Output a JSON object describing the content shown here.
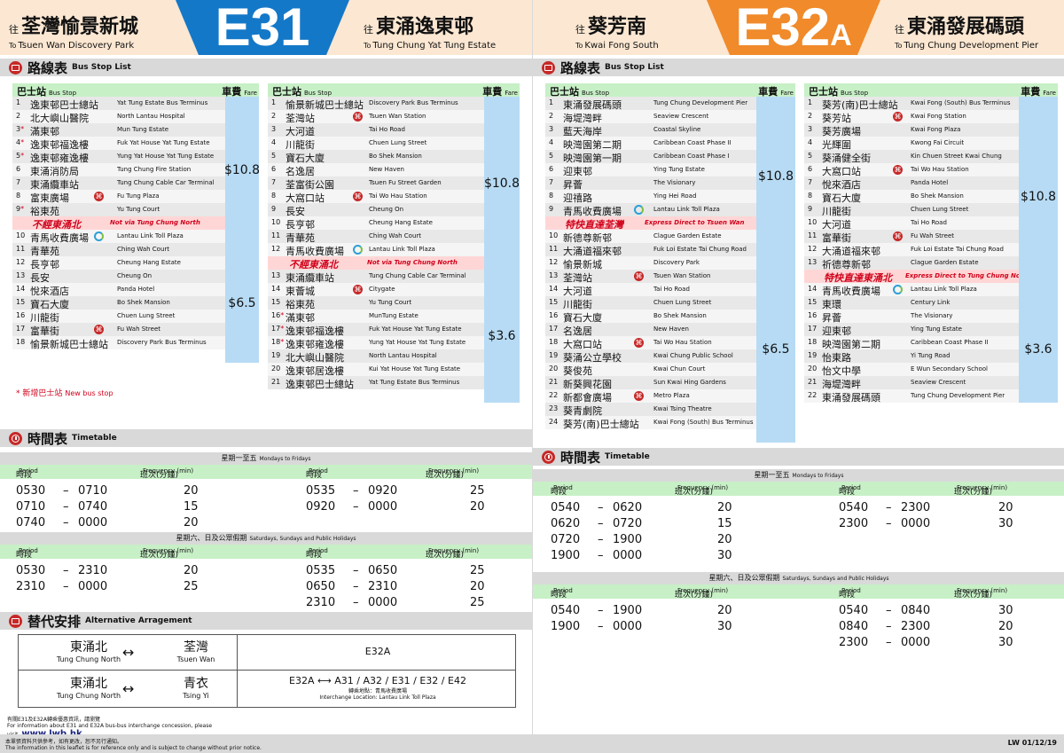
{
  "colors": {
    "e31_badge": "#1478c8",
    "e32a_badge": "#f08a2a",
    "header_bg": "#fbe7d2",
    "section_bar": "#d9d9d9",
    "green_head": "#c7f0c6",
    "fare_blue": "#b7dbf4",
    "express_pink": "#ffd6d6",
    "red": "#d0021b"
  },
  "left": {
    "header": {
      "origin_prefix": "往",
      "origin_zh": "荃灣愉景新城",
      "origin_to": "To",
      "origin_en": "Tsuen Wan Discovery Park",
      "route": "E31",
      "dest_prefix": "往",
      "dest_zh": "東涌逸東邨",
      "dest_to": "To",
      "dest_en": "Tung Chung Yat Tung Estate"
    },
    "stops_title": {
      "zh": "路線表",
      "en": "Bus Stop List"
    },
    "stop_header": {
      "stop_zh": "巴士站",
      "stop_en": "Bus Stop",
      "fare_zh": "車費",
      "fare_en": "Fare"
    },
    "col1": [
      {
        "n": "1",
        "zh": "逸東邨巴士總站",
        "en": "Yat Tung Estate Bus Terminus"
      },
      {
        "n": "2",
        "zh": "北大嶼山醫院",
        "en": "North Lantau Hospital"
      },
      {
        "n": "3",
        "ast": "*",
        "zh": "滿東邨",
        "en": "Mun Tung Estate"
      },
      {
        "n": "4",
        "ast": "*",
        "zh": "逸東邨福逸樓",
        "en": "Fuk Yat House Yat Tung Estate"
      },
      {
        "n": "5",
        "ast": "*",
        "zh": "逸東邨雍逸樓",
        "en": "Yung Yat House Yat Tung Estate"
      },
      {
        "n": "6",
        "zh": "東涌消防局",
        "en": "Tung Chung Fire Station"
      },
      {
        "n": "7",
        "zh": "東涌纜車站",
        "en": "Tung Chung Cable Car Terminal"
      },
      {
        "n": "8",
        "zh": "富東廣場",
        "en": "Fu Tung Plaza",
        "mtr": true
      },
      {
        "n": "9",
        "ast": "*",
        "zh": "裕東苑",
        "en": "Yu Tung Court"
      },
      {
        "exp": true,
        "zh": "不經東涌北",
        "en": "Not via Tung Chung North"
      },
      {
        "n": "10",
        "zh": "青馬收費廣場",
        "en": "Lantau Link Toll Plaza",
        "toll": true
      },
      {
        "n": "11",
        "zh": "青華苑",
        "en": "Ching Wah Court"
      },
      {
        "n": "12",
        "zh": "長亨邨",
        "en": "Cheung Hang Estate"
      },
      {
        "n": "13",
        "zh": "長安",
        "en": "Cheung On"
      },
      {
        "n": "14",
        "zh": "悅來酒店",
        "en": "Panda Hotel"
      },
      {
        "n": "15",
        "zh": "寶石大廈",
        "en": "Bo Shek Mansion"
      },
      {
        "n": "16",
        "zh": "川龍街",
        "en": "Chuen Lung Street"
      },
      {
        "n": "17",
        "zh": "富華街",
        "en": "Fu Wah Street",
        "mtr": true
      },
      {
        "n": "18",
        "zh": "愉景新城巴士總站",
        "en": "Discovery Park Bus Terminus"
      }
    ],
    "col1_fares": [
      "$10.8",
      "$6.5"
    ],
    "col2": [
      {
        "n": "1",
        "zh": "愉景新城巴士總站",
        "en": "Discovery Park Bus Terminus"
      },
      {
        "n": "2",
        "zh": "荃灣站",
        "en": "Tsuen Wan Station",
        "mtr": true
      },
      {
        "n": "3",
        "zh": "大河道",
        "en": "Tai Ho Road"
      },
      {
        "n": "4",
        "zh": "川龍街",
        "en": "Chuen Lung Street"
      },
      {
        "n": "5",
        "zh": "寶石大廈",
        "en": "Bo Shek Mansion"
      },
      {
        "n": "6",
        "zh": "名逸居",
        "en": "New Haven"
      },
      {
        "n": "7",
        "zh": "荃富街公園",
        "en": "Tsuen Fu Street Garden"
      },
      {
        "n": "8",
        "zh": "大窩口站",
        "en": "Tai Wo Hau Station",
        "mtr": true
      },
      {
        "n": "9",
        "zh": "長安",
        "en": "Cheung On"
      },
      {
        "n": "10",
        "zh": "長亨邨",
        "en": "Cheung Hang Estate"
      },
      {
        "n": "11",
        "zh": "青華苑",
        "en": "Ching Wah Court"
      },
      {
        "n": "12",
        "zh": "青馬收費廣場",
        "en": "Lantau Link Toll Plaza",
        "toll": true
      },
      {
        "exp": true,
        "zh": "不經東涌北",
        "en": "Not via Tung Chung North"
      },
      {
        "n": "13",
        "zh": "東涌纜車站",
        "en": "Tung Chung Cable Car Terminal"
      },
      {
        "n": "14",
        "zh": "東薈城",
        "en": "Citygate",
        "mtr": true
      },
      {
        "n": "15",
        "zh": "裕東苑",
        "en": "Yu Tung Court"
      },
      {
        "n": "16",
        "ast": "*",
        "zh": "滿東邨",
        "en": "MunTung Estate"
      },
      {
        "n": "17",
        "ast": "*",
        "zh": "逸東邨福逸樓",
        "en": "Fuk Yat House Yat Tung Estate"
      },
      {
        "n": "18",
        "ast": "*",
        "zh": "逸東邨雍逸樓",
        "en": "Yung Yat House Yat Tung Estate"
      },
      {
        "n": "19",
        "zh": "北大嶼山醫院",
        "en": "North Lantau Hospital"
      },
      {
        "n": "20",
        "zh": "逸東邨居逸樓",
        "en": "Kui Yat House Yat Tung Estate"
      },
      {
        "n": "21",
        "zh": "逸東邨巴士總站",
        "en": "Yat Tung Estate Bus Terminus"
      }
    ],
    "col2_fares": [
      "$10.8",
      "$3.6"
    ],
    "new_stop_note": {
      "mark": "*",
      "zh": "新增巴士站",
      "en": "New bus stop"
    },
    "timetable_title": {
      "zh": "時間表",
      "en": "Timetable"
    },
    "weekday_label": {
      "zh": "星期一至五",
      "en": "Mondays to Fridays"
    },
    "holiday_label": {
      "zh": "星期六、日及公眾假期",
      "en": "Saturdays, Sundays and Public Holidays"
    },
    "period_label": {
      "zh": "時段",
      "en": "Period"
    },
    "freq_label": {
      "zh": "班次(分鐘)",
      "en": "Frequency (min)"
    },
    "weekday_a": [
      {
        "from": "0530",
        "to": "0710",
        "freq": "20"
      },
      {
        "from": "0710",
        "to": "0740",
        "freq": "15"
      },
      {
        "from": "0740",
        "to": "0000",
        "freq": "20"
      }
    ],
    "weekday_b": [
      {
        "from": "0535",
        "to": "0920",
        "freq": "25"
      },
      {
        "from": "0920",
        "to": "0000",
        "freq": "20"
      }
    ],
    "holiday_a": [
      {
        "from": "0530",
        "to": "2310",
        "freq": "20"
      },
      {
        "from": "2310",
        "to": "0000",
        "freq": "25"
      }
    ],
    "holiday_b": [
      {
        "from": "0535",
        "to": "0650",
        "freq": "25"
      },
      {
        "from": "0650",
        "to": "2310",
        "freq": "20"
      },
      {
        "from": "2310",
        "to": "0000",
        "freq": "25"
      }
    ],
    "alt_title": {
      "zh": "替代安排",
      "en": "Alternative Arragement"
    },
    "alt1": {
      "a_zh": "東涌北",
      "a_en": "Tung Chung North",
      "arrow": "↔",
      "b_zh": "荃灣",
      "b_en": "Tsuen Wan",
      "routes": "E32A"
    },
    "alt2": {
      "a_zh": "東涌北",
      "a_en": "Tung Chung North",
      "arrow": "↔",
      "b_zh": "青衣",
      "b_en": "Tsing Yi",
      "routes": "E32A  ⟷  A31 / A32 / E31 / E32 / E42",
      "loc_zh": "轉乘地點：青馬收費廣場",
      "loc_en": "Interchange Location: Lantau Link Toll Plaza"
    },
    "web_note": {
      "zh": "有關E31及E32A轉乘優惠資訊，請瀏覽",
      "en": "For information about E31 and E32A bus-bus interchange concession, please visit",
      "url": "www.lwb.hk"
    }
  },
  "right": {
    "header": {
      "origin_prefix": "往",
      "origin_zh": "葵芳南",
      "origin_to": "To",
      "origin_en": "Kwai Fong South",
      "route": "E32",
      "route_suffix": "A",
      "dest_prefix": "往",
      "dest_zh": "東涌發展碼頭",
      "dest_to": "To",
      "dest_en": "Tung Chung Development Pier"
    },
    "stops_title": {
      "zh": "路線表",
      "en": "Bus Stop List"
    },
    "col1": [
      {
        "n": "1",
        "zh": "東涌發展碼頭",
        "en": "Tung Chung Development Pier"
      },
      {
        "n": "2",
        "zh": "海堤灣畔",
        "en": "Seaview Crescent"
      },
      {
        "n": "3",
        "zh": "藍天海岸",
        "en": "Coastal Skyline"
      },
      {
        "n": "4",
        "zh": "映灣園第二期",
        "en": "Caribbean Coast Phase II"
      },
      {
        "n": "5",
        "zh": "映灣園第一期",
        "en": "Caribbean Coast Phase I"
      },
      {
        "n": "6",
        "zh": "迎東邨",
        "en": "Ying Tung Estate"
      },
      {
        "n": "7",
        "zh": "昇薈",
        "en": "The Visionary"
      },
      {
        "n": "8",
        "zh": "迎禧路",
        "en": "Ying Hei Road"
      },
      {
        "n": "9",
        "zh": "青馬收費廣場",
        "en": "Lantau Link Toll Plaza",
        "toll": true
      },
      {
        "exp": true,
        "zh": "特快直達荃灣",
        "en": "Express Direct to Tsuen Wan"
      },
      {
        "n": "10",
        "zh": "新德尊新邨",
        "en": "Clague Garden Estate"
      },
      {
        "n": "11",
        "zh": "大涌道福來邨",
        "en": "Fuk Loi Estate Tai Chung Road"
      },
      {
        "n": "12",
        "zh": "愉景新城",
        "en": "Discovery Park"
      },
      {
        "n": "13",
        "zh": "荃灣站",
        "en": "Tsuen Wan Station",
        "mtr": true
      },
      {
        "n": "14",
        "zh": "大河道",
        "en": "Tai Ho Road"
      },
      {
        "n": "15",
        "zh": "川龍街",
        "en": "Chuen Lung Street"
      },
      {
        "n": "16",
        "zh": "寶石大廈",
        "en": "Bo Shek Mansion"
      },
      {
        "n": "17",
        "zh": "名逸居",
        "en": "New Haven"
      },
      {
        "n": "18",
        "zh": "大窩口站",
        "en": "Tai Wo Hau Station",
        "mtr": true
      },
      {
        "n": "19",
        "zh": "葵涌公立學校",
        "en": "Kwai Chung Public School"
      },
      {
        "n": "20",
        "zh": "葵俊苑",
        "en": "Kwai Chun Court"
      },
      {
        "n": "21",
        "zh": "新葵興花園",
        "en": "Sun Kwai Hing Gardens"
      },
      {
        "n": "22",
        "zh": "新都會廣場",
        "en": "Metro Plaza",
        "mtr": true
      },
      {
        "n": "23",
        "zh": "葵青劇院",
        "en": "Kwai Tsing Theatre"
      },
      {
        "n": "24",
        "zh": "葵芳(南)巴士總站",
        "en": "Kwai Fong (South) Bus Terminus"
      }
    ],
    "col1_fares": [
      "$10.8",
      "$6.5"
    ],
    "col2": [
      {
        "n": "1",
        "zh": "葵芳(南)巴士總站",
        "en": "Kwai Fong (South) Bus Terminus"
      },
      {
        "n": "2",
        "zh": "葵芳站",
        "en": "Kwai Fong Station",
        "mtr": true
      },
      {
        "n": "3",
        "zh": "葵芳廣場",
        "en": "Kwai Fong Plaza"
      },
      {
        "n": "4",
        "zh": "光輝圍",
        "en": "Kwong Fai Circuit"
      },
      {
        "n": "5",
        "zh": "葵涌健全街",
        "en": "Kin Chuen Street Kwai Chung"
      },
      {
        "n": "6",
        "zh": "大窩口站",
        "en": "Tai Wo Hau Station",
        "mtr": true
      },
      {
        "n": "7",
        "zh": "悅來酒店",
        "en": "Panda Hotel"
      },
      {
        "n": "8",
        "zh": "寶石大廈",
        "en": "Bo Shek Mansion"
      },
      {
        "n": "9",
        "zh": "川龍街",
        "en": "Chuen Lung Street"
      },
      {
        "n": "10",
        "zh": "大河道",
        "en": "Tai Ho Road"
      },
      {
        "n": "11",
        "zh": "富華街",
        "en": "Fu Wah Street",
        "mtr": true
      },
      {
        "n": "12",
        "zh": "大涌道福來邨",
        "en": "Fuk Loi Estate Tai Chung Road"
      },
      {
        "n": "13",
        "zh": "祈德尊新邨",
        "en": "Clague Garden Estate"
      },
      {
        "exp": true,
        "zh": "特快直達東涌北",
        "en": "Express Direct to Tung Chung North"
      },
      {
        "n": "14",
        "zh": "青馬收費廣場",
        "en": "Lantau Link Toll Plaza",
        "toll": true
      },
      {
        "n": "15",
        "zh": "東環",
        "en": "Century Link"
      },
      {
        "n": "16",
        "zh": "昇薈",
        "en": "The Visionary"
      },
      {
        "n": "17",
        "zh": "迎東邨",
        "en": "Ying Tung Estate"
      },
      {
        "n": "18",
        "zh": "映灣園第二期",
        "en": "Caribbean Coast Phase II"
      },
      {
        "n": "19",
        "zh": "怡東路",
        "en": "Yi Tung Road"
      },
      {
        "n": "20",
        "zh": "怡文中學",
        "en": "E Wun Secondary School"
      },
      {
        "n": "21",
        "zh": "海堤灣畔",
        "en": "Seaview Crescent"
      },
      {
        "n": "22",
        "zh": "東涌發展碼頭",
        "en": "Tung Chung Development Pier"
      }
    ],
    "col2_fares": [
      "$10.8",
      "$3.6"
    ],
    "timetable_title": {
      "zh": "時間表",
      "en": "Timetable"
    },
    "weekday_a": [
      {
        "from": "0540",
        "to": "0620",
        "freq": "20"
      },
      {
        "from": "0620",
        "to": "0720",
        "freq": "15"
      },
      {
        "from": "0720",
        "to": "1900",
        "freq": "20"
      },
      {
        "from": "1900",
        "to": "0000",
        "freq": "30"
      }
    ],
    "weekday_b": [
      {
        "from": "0540",
        "to": "2300",
        "freq": "20"
      },
      {
        "from": "2300",
        "to": "0000",
        "freq": "30"
      }
    ],
    "holiday_a": [
      {
        "from": "0540",
        "to": "1900",
        "freq": "20"
      },
      {
        "from": "1900",
        "to": "0000",
        "freq": "30"
      }
    ],
    "holiday_b": [
      {
        "from": "0540",
        "to": "0840",
        "freq": "30"
      },
      {
        "from": "0840",
        "to": "2300",
        "freq": "20"
      },
      {
        "from": "2300",
        "to": "0000",
        "freq": "30"
      }
    ]
  },
  "footer": {
    "disclaimer_zh": "本單張資料只供參考，如有更改，恕不另行通知。",
    "disclaimer_en": "The information in this leaflet is for reference only and is subject to change without prior notice.",
    "code": "LW  01/12/19"
  }
}
